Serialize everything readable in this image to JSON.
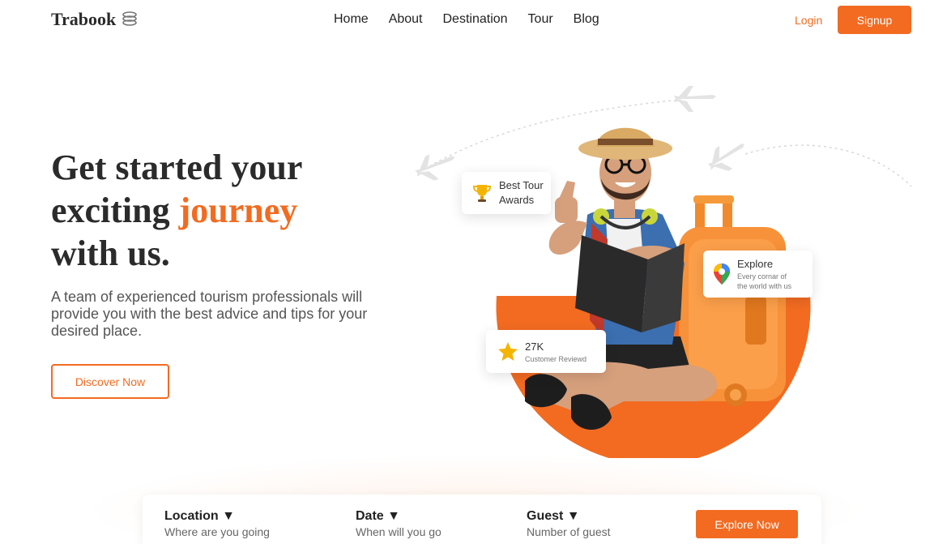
{
  "brand": {
    "name": "Trabook",
    "accent": "#f26b21"
  },
  "nav": {
    "links": [
      "Home",
      "About",
      "Destination",
      "Tour",
      "Blog"
    ],
    "login": "Login",
    "signup": "Signup"
  },
  "hero": {
    "title_line1": "Get started your",
    "title_line2_pre": "exciting ",
    "title_line2_accent": "journey",
    "title_line3": "with us.",
    "subtitle": "A team of experienced tourism professionals will provide you with the best advice and tips for your desired place.",
    "cta": "Discover Now"
  },
  "cards": {
    "awards": {
      "line1": "Best Tour",
      "line2": "Awards",
      "icon": "trophy-icon"
    },
    "explore": {
      "title": "Explore",
      "line1": "Every cornar of",
      "line2": "the world with us",
      "icon": "map-pin-icon"
    },
    "reviews": {
      "title": "27K",
      "subtitle": "Customer Reviewd",
      "icon": "star-icon"
    }
  },
  "search": {
    "location": {
      "label": "Location ▼",
      "hint": "Where are you going"
    },
    "date": {
      "label": "Date ▼",
      "hint": "When will you go"
    },
    "guest": {
      "label": "Guest ▼",
      "hint": "Number of guest"
    },
    "button": "Explore Now"
  }
}
